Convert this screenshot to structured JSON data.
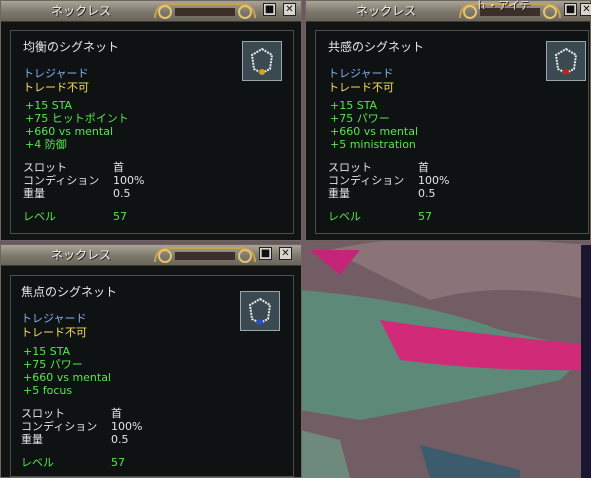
{
  "windows": [
    {
      "title": "ネックレス",
      "item_name": "均衡のシグネット",
      "tag_treasured": "トレジャード",
      "tag_notrade": "トレード不可",
      "stats": [
        "+15 STA",
        "+75 ヒットポイント",
        "+660 vs mental",
        "+4 防御"
      ],
      "slot_label": "スロット",
      "slot_value": "首",
      "condition_label": "コンディション",
      "condition_value": "100%",
      "weight_label": "重量",
      "weight_value": "0.5",
      "level_label": "レベル",
      "level_value": "57",
      "gem_color": "#d4a020"
    },
    {
      "title": "ネックレス",
      "item_name": "共感のシグネット",
      "tag_treasured": "トレジャード",
      "tag_notrade": "トレード不可",
      "stats": [
        "+15 STA",
        "+75 パワー",
        "+660 vs mental",
        "+5 ministration"
      ],
      "slot_label": "スロット",
      "slot_value": "首",
      "condition_label": "コンディション",
      "condition_value": "100%",
      "weight_label": "重量",
      "weight_value": "0.5",
      "level_label": "レベル",
      "level_value": "57",
      "gem_color": "#c02020"
    },
    {
      "title": "ネックレス",
      "item_name": "焦点のシグネット",
      "tag_treasured": "トレジャード",
      "tag_notrade": "トレード不可",
      "stats": [
        "+15 STA",
        "+75 パワー",
        "+660 vs mental",
        "+5 focus"
      ],
      "slot_label": "スロット",
      "slot_value": "首",
      "condition_label": "コンディション",
      "condition_value": "100%",
      "weight_label": "重量",
      "weight_value": "0.5",
      "level_label": "レベル",
      "level_value": "57",
      "gem_color": "#2050d0"
    }
  ],
  "buttons": {
    "minimize": "■",
    "close": "✕"
  },
  "background_tab_partial": "ｈ・アイテ"
}
